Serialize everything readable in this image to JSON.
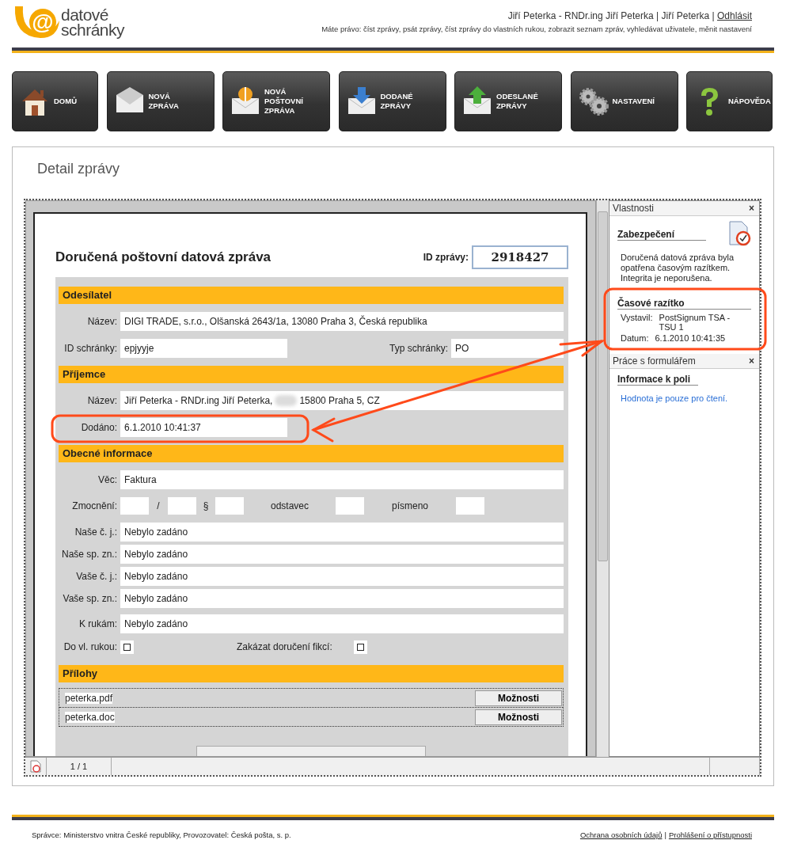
{
  "header": {
    "logo": {
      "mark": "@",
      "line1": "datové",
      "line2": "schránky"
    },
    "user": "Jiří Peterka - RNDr.ing Jiří Peterka | Jiří Peterka |",
    "logout": "Odhlásit",
    "rights": "Máte právo: číst zprávy, psát zprávy, číst zprávy do vlastních rukou, zobrazit seznam zpráv, vyhledávat uživatele, měnit nastavení"
  },
  "nav": [
    {
      "kind": "home",
      "lines": [
        "DOMŮ"
      ]
    },
    {
      "kind": "envelope",
      "lines": [
        "NOVÁ",
        "ZPRÁVA"
      ]
    },
    {
      "kind": "money",
      "lines": [
        "NOVÁ",
        "POŠTOVNÍ",
        "ZPRÁVA"
      ]
    },
    {
      "kind": "inbox",
      "lines": [
        "DODANÉ",
        "ZPRÁVY"
      ]
    },
    {
      "kind": "outbox",
      "lines": [
        "ODESLANÉ",
        "ZPRÁVY"
      ]
    },
    {
      "kind": "gears",
      "lines": [
        "NASTAVENÍ"
      ]
    },
    {
      "kind": "help",
      "lines": [
        "NÁPOVĚDA"
      ]
    }
  ],
  "page_title": "Detail zprávy",
  "document": {
    "title": "Doručená poštovní datová zpráva",
    "id_label": "ID zprávy:",
    "id_value": "2918427",
    "sender": {
      "heading": "Odesílatel",
      "name_label": "Název:",
      "name": "DIGI TRADE, s.r.o., Olšanská 2643/1a, 13080 Praha 3, Česká republika",
      "box_id_label": "ID schránky:",
      "box_id": "epjyyje",
      "box_type_label": "Typ schránky:",
      "box_type": "PO"
    },
    "recipient": {
      "heading": "Příjemce",
      "name_label": "Název:",
      "name": "Jiří Peterka - RNDr.ing Jiří Peterka,",
      "name_rest": "15800 Praha 5, CZ",
      "delivered_label": "Dodáno:",
      "delivered": "6.1.2010 10:41:37"
    },
    "general": {
      "heading": "Obecné informace",
      "subject_label": "Věc:",
      "subject": "Faktura",
      "auth_label": "Zmocnění:",
      "slash": "/",
      "section_sign": "§",
      "paragraph_label": "odstavec",
      "letter_label": "písmeno",
      "refs": [
        {
          "label": "Naše č. j.:",
          "value": "Nebylo zadáno"
        },
        {
          "label": "Naše sp. zn.:",
          "value": "Nebylo zadáno"
        },
        {
          "label": "Vaše č. j.:",
          "value": "Nebylo zadáno"
        },
        {
          "label": "Vaše sp. zn.:",
          "value": "Nebylo zadáno"
        }
      ],
      "hands_label": "K rukám:",
      "hands": "Nebylo zadáno",
      "personal": {
        "label": "Do vl. rukou:",
        "checked": false
      },
      "fiction": {
        "label": "Zakázat doručení fikcí:",
        "checked": false
      }
    },
    "attachments": {
      "heading": "Přílohy",
      "files": [
        {
          "name": "peterka.pdf",
          "button": "Možnosti"
        },
        {
          "name": "peterka.doc",
          "button": "Možnosti"
        }
      ]
    }
  },
  "side": {
    "title": "Vlastnosti",
    "close": "×",
    "security": {
      "heading": "Zabezpečení",
      "text": "Doručená datová zpráva byla opatřena  časovým razítkem. Integrita je neporušena."
    },
    "timestamp": {
      "heading": "Časové razítko",
      "issuer_label": "Vystavil:",
      "issuer": "PostSignum TSA - TSU 1",
      "date_label": "Datum:",
      "date": "6.1.2010 10:41:35"
    },
    "form_panel": {
      "title": "Práce s formulářem",
      "close": "×"
    },
    "field_info": {
      "heading": "Informace k poli",
      "text": "Hodnota je pouze pro čtení."
    }
  },
  "status": {
    "page": "1 / 1"
  },
  "footer": {
    "text": "Správce: Ministerstvo vnitra České republiky, Provozovatel: Česká pošta, s. p.",
    "links": [
      {
        "label": "Ochrana osobních údajů"
      },
      {
        "label": "Prohlášení o přístupnosti"
      }
    ],
    "separator": "|"
  }
}
